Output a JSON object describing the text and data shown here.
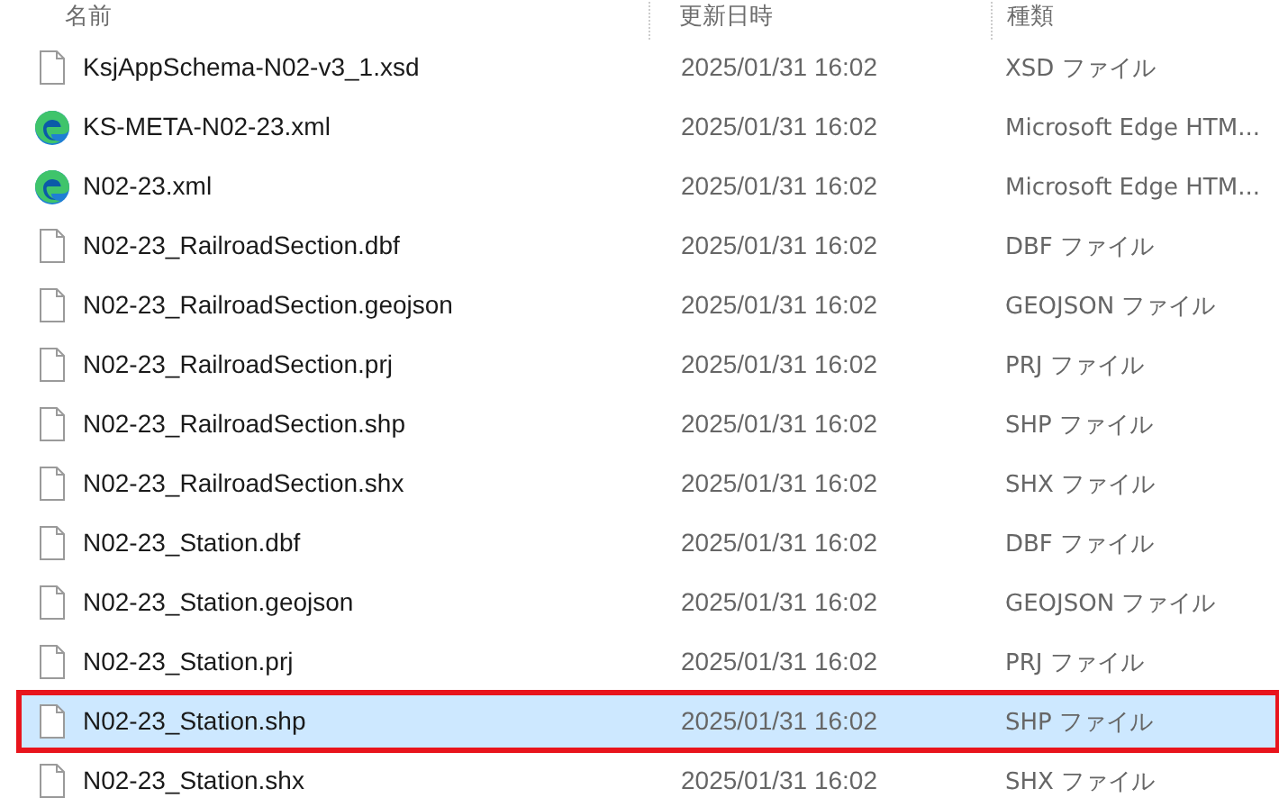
{
  "columns": [
    {
      "label": "名前"
    },
    {
      "label": "更新日時"
    },
    {
      "label": "種類"
    }
  ],
  "rows": [
    {
      "kind": "file",
      "name": "KsjAppSchema-N02-v3_1.xsd",
      "date": "2025/01/31 16:02",
      "type": "XSD ファイル",
      "selected": false,
      "outlined": false
    },
    {
      "kind": "edge",
      "name": "KS-META-N02-23.xml",
      "date": "2025/01/31 16:02",
      "type": "Microsoft Edge HTM...",
      "selected": false,
      "outlined": false
    },
    {
      "kind": "edge",
      "name": "N02-23.xml",
      "date": "2025/01/31 16:02",
      "type": "Microsoft Edge HTM...",
      "selected": false,
      "outlined": false
    },
    {
      "kind": "file",
      "name": "N02-23_RailroadSection.dbf",
      "date": "2025/01/31 16:02",
      "type": "DBF ファイル",
      "selected": false,
      "outlined": false
    },
    {
      "kind": "file",
      "name": "N02-23_RailroadSection.geojson",
      "date": "2025/01/31 16:02",
      "type": "GEOJSON ファイル",
      "selected": false,
      "outlined": false
    },
    {
      "kind": "file",
      "name": "N02-23_RailroadSection.prj",
      "date": "2025/01/31 16:02",
      "type": "PRJ ファイル",
      "selected": false,
      "outlined": false
    },
    {
      "kind": "file",
      "name": "N02-23_RailroadSection.shp",
      "date": "2025/01/31 16:02",
      "type": "SHP ファイル",
      "selected": false,
      "outlined": false
    },
    {
      "kind": "file",
      "name": "N02-23_RailroadSection.shx",
      "date": "2025/01/31 16:02",
      "type": "SHX ファイル",
      "selected": false,
      "outlined": false
    },
    {
      "kind": "file",
      "name": "N02-23_Station.dbf",
      "date": "2025/01/31 16:02",
      "type": "DBF ファイル",
      "selected": false,
      "outlined": false
    },
    {
      "kind": "file",
      "name": "N02-23_Station.geojson",
      "date": "2025/01/31 16:02",
      "type": "GEOJSON ファイル",
      "selected": false,
      "outlined": false
    },
    {
      "kind": "file",
      "name": "N02-23_Station.prj",
      "date": "2025/01/31 16:02",
      "type": "PRJ ファイル",
      "selected": false,
      "outlined": false
    },
    {
      "kind": "file",
      "name": "N02-23_Station.shp",
      "date": "2025/01/31 16:02",
      "type": "SHP ファイル",
      "selected": true,
      "outlined": true
    },
    {
      "kind": "file",
      "name": "N02-23_Station.shx",
      "date": "2025/01/31 16:02",
      "type": "SHX ファイル",
      "selected": false,
      "outlined": false
    }
  ]
}
